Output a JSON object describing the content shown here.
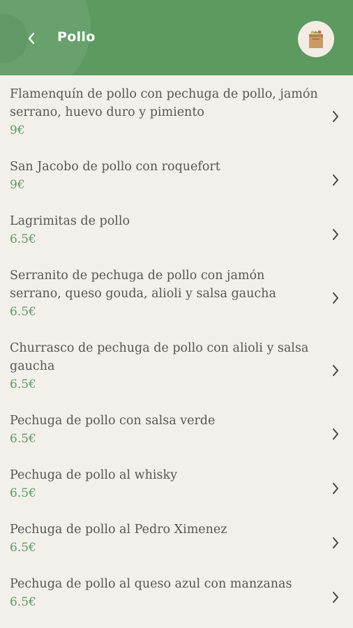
{
  "header": {
    "title": "Pollo",
    "back_icon": "chevron-left-icon",
    "cart_icon": "shopping-bag-icon",
    "background": "#5c9a60"
  },
  "colors": {
    "price": "#5c9a60",
    "text": "#5b5450",
    "page_bg": "#f3f0ec"
  },
  "items": [
    {
      "name": "Flamenquín de pollo con pechuga de pollo, jamón serrano, huevo duro y pimiento",
      "price": "9€"
    },
    {
      "name": "San Jacobo de pollo con roquefort",
      "price": "9€"
    },
    {
      "name": "Lagrimitas de pollo",
      "price": "6.5€"
    },
    {
      "name": "Serranito de pechuga de pollo con jamón serrano, queso gouda, alioli y salsa gaucha",
      "price": "6.5€"
    },
    {
      "name": "Churrasco de pechuga de pollo con alioli y salsa gaucha",
      "price": "6.5€"
    },
    {
      "name": "Pechuga de pollo con salsa verde",
      "price": "6.5€"
    },
    {
      "name": "Pechuga de pollo al whisky",
      "price": "6.5€"
    },
    {
      "name": "Pechuga de pollo al Pedro Ximenez",
      "price": "6.5€"
    },
    {
      "name": "Pechuga de pollo al queso azul con manzanas",
      "price": "6.5€"
    }
  ]
}
